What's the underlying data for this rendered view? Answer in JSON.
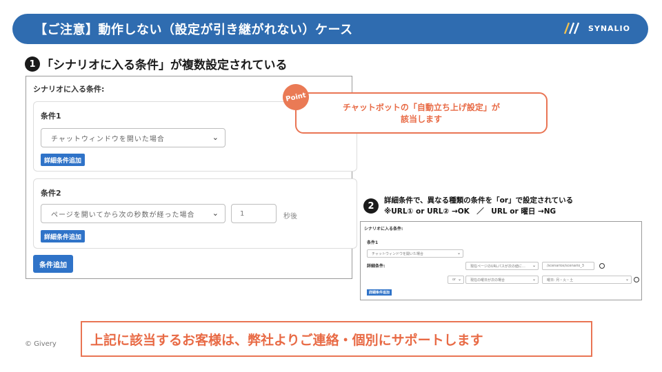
{
  "header": {
    "title": "【ご注意】動作しない（設定が引き継がれない）ケース",
    "brand": "SYNALIO",
    "accent": "#2f6cb0"
  },
  "section1": {
    "number": "1",
    "title": "「シナリオに入る条件」が複数設定されている",
    "panel_label": "シナリオに入る条件:",
    "conditions": [
      {
        "title": "条件1",
        "select_value": "チャットウィンドウを開いた場合",
        "add_detail_label": "詳細条件追加"
      },
      {
        "title": "条件2",
        "select_value": "ページを開いてから次の秒数が経った場合",
        "number_value": "1",
        "unit": "秒後",
        "add_detail_label": "詳細条件追加"
      }
    ],
    "add_condition_label": "条件追加"
  },
  "point": {
    "badge": "Point",
    "line1": "チャットボットの「自動立ち上げ設定」が",
    "line2": "該当します",
    "color": "#e86a45"
  },
  "section2": {
    "number": "2",
    "line1": "詳細条件で、異なる種類の条件を「or」で設定されている",
    "line2": "※URL① or URL② →OK　／　URL or 曜日 →NG",
    "panel_label": "シナリオに入る条件:",
    "condition_title": "条件1",
    "select_value": "チャットウィンドウを開いた場合",
    "detail_label": "詳細条件:",
    "detail_select_1": "現在ページのURLパスが次の値に…",
    "detail_value_1": "/scenarios/scenario_3",
    "or_select": "or",
    "detail_select_2": "現在の曜日が次の場合",
    "detail_value_2": "曜日: 月・火・土",
    "add_detail_label": "詳細条件追加"
  },
  "footer": {
    "message": "上記に該当するお客様は、弊社よりご連絡・個別にサポートします",
    "copyright": "© Givery"
  }
}
